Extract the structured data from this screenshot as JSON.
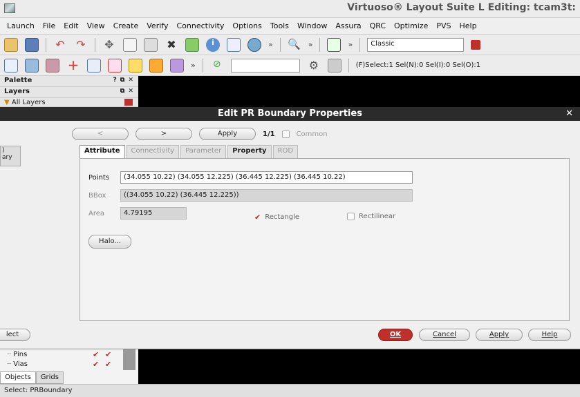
{
  "window": {
    "title": "Virtuoso® Layout Suite L Editing: tcam3t:"
  },
  "menu": [
    "Launch",
    "File",
    "Edit",
    "View",
    "Create",
    "Verify",
    "Connectivity",
    "Options",
    "Tools",
    "Window",
    "Assura",
    "QRC",
    "Optimize",
    "PVS",
    "Help"
  ],
  "toolbar": {
    "mode_combo": "Classic",
    "select_status": "(F)Select:1 Sel(N):0 Sel(I):0 Sel(O):1"
  },
  "dock": {
    "palette": "Palette",
    "layers": "Layers",
    "all_layers": "All Layers",
    "ctrl_palette": "? ⧉ ✕",
    "ctrl_layers": "⧉ ✕",
    "side_text": ")\nary",
    "pins": "Pins",
    "vias": "Vias",
    "tab_objects": "Objects",
    "tab_grids": "Grids"
  },
  "dialog": {
    "title": "Edit PR Boundary Properties",
    "nav": {
      "prev": "<",
      "next": ">",
      "apply": "Apply",
      "count": "1/1",
      "common": "Common"
    },
    "tabs": [
      "Attribute",
      "Connectivity",
      "Parameter",
      "Property",
      "ROD"
    ],
    "points_label": "Points",
    "points_value": "(34.055 10.22) (34.055 12.225) (36.445 12.225) (36.445 10.22)",
    "bbox_label": "BBox",
    "bbox_value": "((34.055 10.22) (36.445 12.225))",
    "area_label": "Area",
    "area_value": "4.79195",
    "rectangle_label": "Rectangle",
    "rectilinear_label": "Rectilinear",
    "halo_button": "Halo...",
    "buttons": {
      "select": "lect",
      "ok": "OK",
      "cancel": "Cancel",
      "apply": "Apply",
      "help": "Help"
    }
  },
  "status": "Select: PRBoundary"
}
